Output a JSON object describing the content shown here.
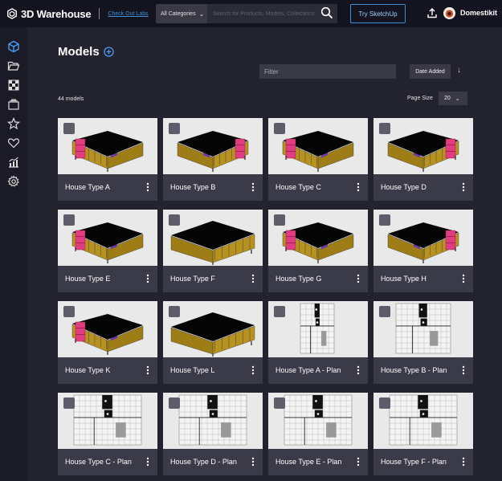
{
  "header": {
    "brand": "3D Warehouse",
    "labs_link": "Check Out Labs",
    "category": "All Categories",
    "search_placeholder": "Search for Products, Models, Collections",
    "try_button": "Try SketchUp",
    "username": "Domestikit"
  },
  "sidebar": {
    "items": [
      "models-icon",
      "folder-icon",
      "materials-icon",
      "collections-icon",
      "star-icon",
      "heart-icon",
      "analytics-icon",
      "settings-icon"
    ]
  },
  "main": {
    "title": "Models",
    "filter_placeholder": "Filter",
    "sort_label": "Date Added",
    "model_count": "44 models",
    "page_size_label": "Page Size",
    "page_size_value": "20"
  },
  "models": [
    {
      "name": "House Type A",
      "kind": "house"
    },
    {
      "name": "House Type B",
      "kind": "house"
    },
    {
      "name": "House Type C",
      "kind": "house"
    },
    {
      "name": "House Type D",
      "kind": "house"
    },
    {
      "name": "House Type E",
      "kind": "house"
    },
    {
      "name": "House Type F",
      "kind": "house"
    },
    {
      "name": "House Type G",
      "kind": "house"
    },
    {
      "name": "House Type H",
      "kind": "house"
    },
    {
      "name": "House Type K",
      "kind": "house"
    },
    {
      "name": "House Type L",
      "kind": "house"
    },
    {
      "name": "House Type A - Plan",
      "kind": "plan"
    },
    {
      "name": "House Type B - Plan",
      "kind": "plan"
    },
    {
      "name": "House Type C - Plan",
      "kind": "plan"
    },
    {
      "name": "House Type D - Plan",
      "kind": "plan"
    },
    {
      "name": "House Type E - Plan",
      "kind": "plan"
    },
    {
      "name": "House Type F - Plan",
      "kind": "plan"
    }
  ],
  "colors": {
    "accent": "#3d8fd6",
    "roof": "#050505",
    "wall": "#b8921e",
    "pink": "#e23c82",
    "purple": "#6a3aa8"
  }
}
